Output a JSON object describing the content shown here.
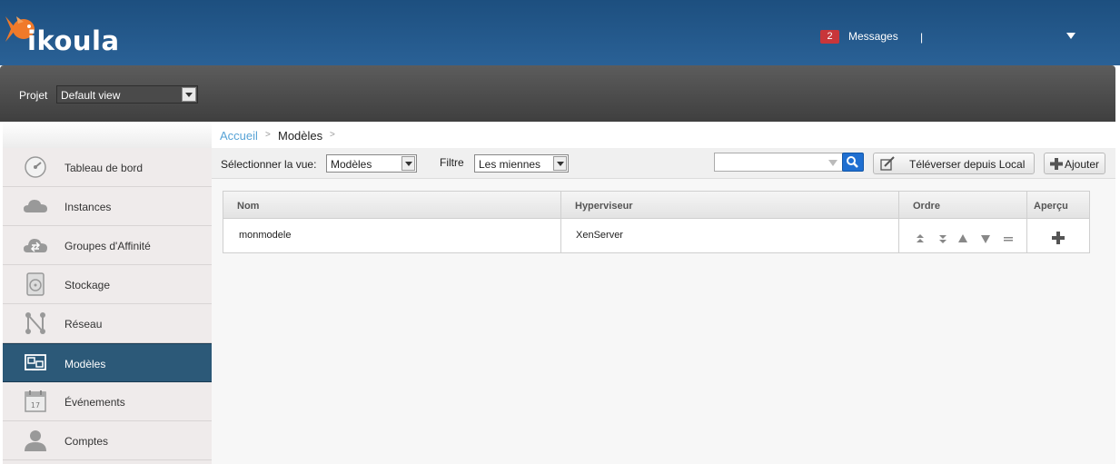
{
  "header": {
    "logo_text": "ikoula",
    "messages_count": "2",
    "messages_label": "Messages",
    "separator": "|"
  },
  "project": {
    "label": "Projet",
    "selected": "Default view"
  },
  "sidebar": {
    "items": [
      {
        "label": "Tableau de bord",
        "icon": "dashboard-icon"
      },
      {
        "label": "Instances",
        "icon": "cloud-icon"
      },
      {
        "label": "Groupes d'Affinité",
        "icon": "affinity-cloud-icon"
      },
      {
        "label": "Stockage",
        "icon": "storage-icon"
      },
      {
        "label": "Réseau",
        "icon": "network-icon"
      },
      {
        "label": "Modèles",
        "icon": "templates-icon",
        "active": true
      },
      {
        "label": "Événements",
        "icon": "calendar-icon"
      },
      {
        "label": "Comptes",
        "icon": "user-icon"
      }
    ]
  },
  "breadcrumb": {
    "home": "Accueil",
    "sep": ">",
    "current": "Modèles"
  },
  "toolbar": {
    "view_label": "Sélectionner la vue:",
    "view_selected": "Modèles",
    "filter_label": "Filtre",
    "filter_selected": "Les miennes",
    "search_value": "",
    "upload_label": "Téléverser depuis Local",
    "add_label": "Ajouter"
  },
  "table": {
    "columns": [
      "Nom",
      "Hyperviseur",
      "Ordre",
      "Aperçu"
    ],
    "rows": [
      {
        "name": "monmodele",
        "hypervisor": "XenServer"
      }
    ]
  },
  "colors": {
    "header_blue": "#1d4f7f",
    "active_nav": "#2c5978",
    "badge_red": "#c8363a",
    "link_blue": "#57a3d6",
    "search_blue": "#1f6fd1"
  }
}
